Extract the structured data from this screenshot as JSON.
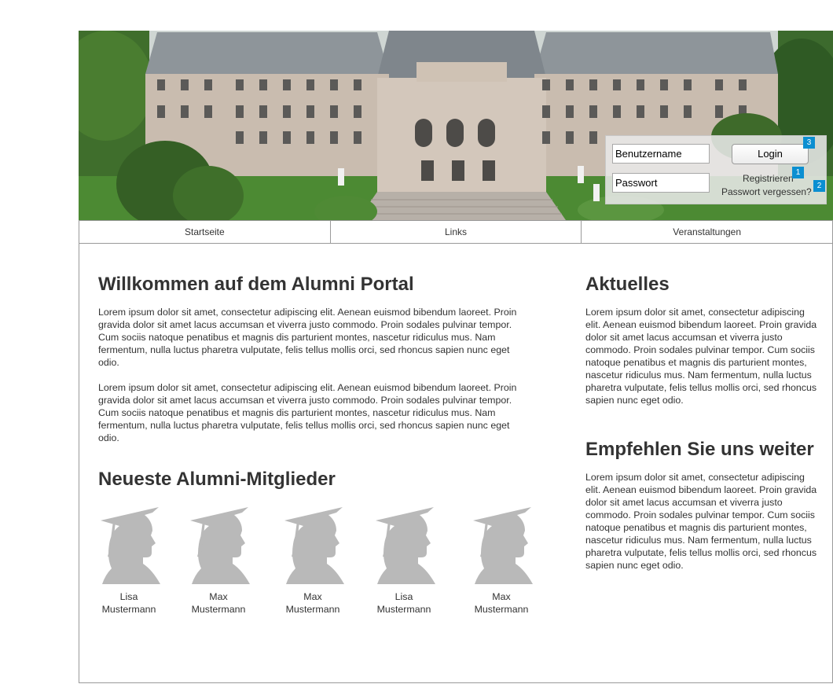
{
  "login": {
    "username_placeholder": "Benutzername",
    "password_placeholder": "Passwort",
    "login_label": "Login",
    "register_label": "Registrieren",
    "forgot_label": "Passwort vergessen?",
    "badges": [
      "1",
      "2",
      "3"
    ]
  },
  "nav": {
    "tabs": [
      {
        "label": "Startseite"
      },
      {
        "label": "Links"
      },
      {
        "label": "Veranstaltungen"
      }
    ]
  },
  "main": {
    "welcome_title": "Willkommen auf dem Alumni Portal",
    "welcome_paragraphs": [
      "Lorem ipsum dolor sit amet, consectetur adipiscing elit. Aenean euismod bibendum laoreet. Proin gravida dolor sit amet lacus accumsan et viverra justo commodo. Proin sodales pulvinar tempor. Cum sociis natoque penatibus et magnis dis parturient montes, nascetur ridiculus mus. Nam fermentum, nulla luctus pharetra vulputate, felis tellus mollis orci, sed rhoncus sapien nunc eget odio.",
      "Lorem ipsum dolor sit amet, consectetur adipiscing elit. Aenean euismod bibendum laoreet. Proin gravida dolor sit amet lacus accumsan et viverra justo commodo. Proin sodales pulvinar tempor. Cum sociis natoque penatibus et magnis dis parturient montes, nascetur ridiculus mus. Nam fermentum, nulla luctus pharetra vulputate, felis tellus mollis orci, sed rhoncus sapien nunc eget odio."
    ],
    "members_title": "Neueste Alumni-Mitglieder",
    "members": [
      {
        "first": "Lisa",
        "last": "Mustermann",
        "icon": "graduate-silhouette-icon"
      },
      {
        "first": "Max",
        "last": "Mustermann",
        "icon": "graduate-silhouette-icon"
      },
      {
        "first": "Max",
        "last": "Mustermann",
        "icon": "graduate-silhouette-icon"
      },
      {
        "first": "Lisa",
        "last": "Mustermann",
        "icon": "graduate-silhouette-icon"
      },
      {
        "first": "Max",
        "last": "Mustermann",
        "icon": "graduate-silhouette-icon"
      }
    ]
  },
  "sidebar": {
    "news_title": "Aktuelles",
    "news_text": "Lorem ipsum dolor sit amet, consectetur adipiscing elit. Aenean euismod bibendum laoreet. Proin gravida dolor sit amet lacus accumsan et viverra justo commodo. Proin sodales pulvinar tempor. Cum sociis natoque penatibus et magnis dis parturient montes, nascetur ridiculus mus. Nam fermentum, nulla luctus pharetra vulputate, felis tellus mollis orci, sed rhoncus sapien nunc eget odio.",
    "recommend_title": "Empfehlen Sie uns weiter",
    "recommend_text": "Lorem ipsum dolor sit amet, consectetur adipiscing elit. Aenean euismod bibendum laoreet. Proin gravida dolor sit amet lacus accumsan et viverra justo commodo. Proin sodales pulvinar tempor. Cum sociis natoque penatibus et magnis dis parturient montes, nascetur ridiculus mus. Nam fermentum, nulla luctus pharetra vulputate, felis tellus mollis orci, sed rhoncus sapien nunc eget odio."
  },
  "colors": {
    "badge": "#0b8fd1",
    "text": "#333333",
    "border": "#9a9a9a",
    "silhouette": "#b9b9b9"
  }
}
